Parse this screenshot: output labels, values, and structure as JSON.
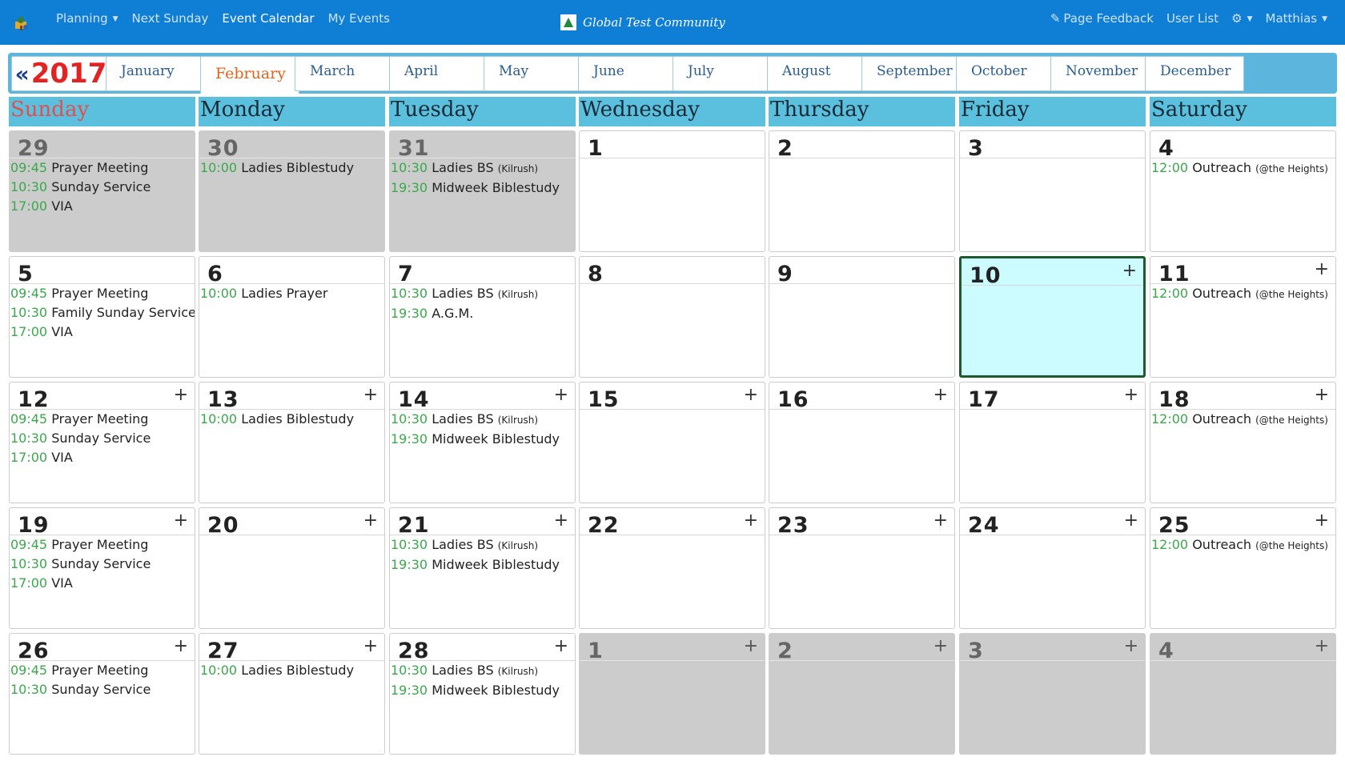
{
  "navbar": {
    "logo_icon": "app-logo-icon",
    "left_items": [
      "Planning",
      "Next Sunday",
      "Event Calendar",
      "My Events"
    ],
    "active_item": "Event Calendar",
    "community": "Global Test Community",
    "page_feedback": "Page Feedback",
    "user_list": "User List",
    "user_name": "Matthias"
  },
  "calendar": {
    "year": "2017",
    "year_arrow": "«",
    "months": [
      "January",
      "February",
      "March",
      "April",
      "May",
      "June",
      "July",
      "August",
      "September",
      "October",
      "November",
      "December"
    ],
    "active_month": "February",
    "weekdays": [
      "Sunday",
      "Monday",
      "Tuesday",
      "Wednesday",
      "Thursday",
      "Friday",
      "Saturday"
    ],
    "weeks": [
      [
        {
          "day": "29",
          "other": true,
          "plus": false,
          "events": [
            {
              "time": "09:45",
              "title": "Prayer Meeting"
            },
            {
              "time": "10:30",
              "title": "Sunday Service"
            },
            {
              "time": "17:00",
              "title": "VIA"
            }
          ]
        },
        {
          "day": "30",
          "other": true,
          "plus": false,
          "events": [
            {
              "time": "10:00",
              "title": "Ladies Biblestudy"
            }
          ]
        },
        {
          "day": "31",
          "other": true,
          "plus": false,
          "events": [
            {
              "time": "10:30",
              "title": "Ladies BS",
              "loc": "(Kilrush)"
            },
            {
              "time": "19:30",
              "title": "Midweek Biblestudy"
            }
          ]
        },
        {
          "day": "1",
          "other": false,
          "plus": false,
          "events": []
        },
        {
          "day": "2",
          "other": false,
          "plus": false,
          "events": []
        },
        {
          "day": "3",
          "other": false,
          "plus": false,
          "events": []
        },
        {
          "day": "4",
          "other": false,
          "plus": false,
          "events": [
            {
              "time": "12:00",
              "title": "Outreach",
              "loc": "(@the Heights)"
            }
          ]
        }
      ],
      [
        {
          "day": "5",
          "other": false,
          "plus": false,
          "events": [
            {
              "time": "09:45",
              "title": "Prayer Meeting"
            },
            {
              "time": "10:30",
              "title": "Family Sunday Service"
            },
            {
              "time": "17:00",
              "title": "VIA"
            }
          ]
        },
        {
          "day": "6",
          "other": false,
          "plus": false,
          "events": [
            {
              "time": "10:00",
              "title": "Ladies Prayer"
            }
          ]
        },
        {
          "day": "7",
          "other": false,
          "plus": false,
          "events": [
            {
              "time": "10:30",
              "title": "Ladies BS",
              "loc": "(Kilrush)"
            },
            {
              "time": "19:30",
              "title": "A.G.M."
            }
          ]
        },
        {
          "day": "8",
          "other": false,
          "plus": false,
          "events": []
        },
        {
          "day": "9",
          "other": false,
          "plus": false,
          "events": []
        },
        {
          "day": "10",
          "other": false,
          "today": true,
          "plus": true,
          "events": []
        },
        {
          "day": "11",
          "other": false,
          "plus": true,
          "events": [
            {
              "time": "12:00",
              "title": "Outreach",
              "loc": "(@the Heights)"
            }
          ]
        }
      ],
      [
        {
          "day": "12",
          "other": false,
          "plus": true,
          "events": [
            {
              "time": "09:45",
              "title": "Prayer Meeting"
            },
            {
              "time": "10:30",
              "title": "Sunday Service"
            },
            {
              "time": "17:00",
              "title": "VIA"
            }
          ]
        },
        {
          "day": "13",
          "other": false,
          "plus": true,
          "events": [
            {
              "time": "10:00",
              "title": "Ladies Biblestudy"
            }
          ]
        },
        {
          "day": "14",
          "other": false,
          "plus": true,
          "events": [
            {
              "time": "10:30",
              "title": "Ladies BS",
              "loc": "(Kilrush)"
            },
            {
              "time": "19:30",
              "title": "Midweek Biblestudy"
            }
          ]
        },
        {
          "day": "15",
          "other": false,
          "plus": true,
          "events": []
        },
        {
          "day": "16",
          "other": false,
          "plus": true,
          "events": []
        },
        {
          "day": "17",
          "other": false,
          "plus": true,
          "events": []
        },
        {
          "day": "18",
          "other": false,
          "plus": true,
          "events": [
            {
              "time": "12:00",
              "title": "Outreach",
              "loc": "(@the Heights)"
            }
          ]
        }
      ],
      [
        {
          "day": "19",
          "other": false,
          "plus": true,
          "events": [
            {
              "time": "09:45",
              "title": "Prayer Meeting"
            },
            {
              "time": "10:30",
              "title": "Sunday Service"
            },
            {
              "time": "17:00",
              "title": "VIA"
            }
          ]
        },
        {
          "day": "20",
          "other": false,
          "plus": true,
          "events": []
        },
        {
          "day": "21",
          "other": false,
          "plus": true,
          "events": [
            {
              "time": "10:30",
              "title": "Ladies BS",
              "loc": "(Kilrush)"
            },
            {
              "time": "19:30",
              "title": "Midweek Biblestudy"
            }
          ]
        },
        {
          "day": "22",
          "other": false,
          "plus": true,
          "events": []
        },
        {
          "day": "23",
          "other": false,
          "plus": true,
          "events": []
        },
        {
          "day": "24",
          "other": false,
          "plus": true,
          "events": []
        },
        {
          "day": "25",
          "other": false,
          "plus": true,
          "events": [
            {
              "time": "12:00",
              "title": "Outreach",
              "loc": "(@the Heights)"
            }
          ]
        }
      ],
      [
        {
          "day": "26",
          "other": false,
          "plus": true,
          "events": [
            {
              "time": "09:45",
              "title": "Prayer Meeting"
            },
            {
              "time": "10:30",
              "title": "Sunday Service"
            }
          ]
        },
        {
          "day": "27",
          "other": false,
          "plus": true,
          "events": [
            {
              "time": "10:00",
              "title": "Ladies Biblestudy"
            }
          ]
        },
        {
          "day": "28",
          "other": false,
          "plus": true,
          "events": [
            {
              "time": "10:30",
              "title": "Ladies BS",
              "loc": "(Kilrush)"
            },
            {
              "time": "19:30",
              "title": "Midweek Biblestudy"
            }
          ]
        },
        {
          "day": "1",
          "other": true,
          "plus": true,
          "events": []
        },
        {
          "day": "2",
          "other": true,
          "plus": true,
          "events": []
        },
        {
          "day": "3",
          "other": true,
          "plus": true,
          "events": []
        },
        {
          "day": "4",
          "other": true,
          "plus": true,
          "events": []
        }
      ]
    ]
  },
  "colors": {
    "navbar": "#0f7fd6",
    "tabs_bar": "#5cb5dd",
    "weekday_header": "#5bc0de",
    "today_bg": "#ccfcff",
    "today_border": "#1f5a2f",
    "event_time": "#3aa84b",
    "year": "#e32222",
    "active_month": "#e0641e"
  }
}
